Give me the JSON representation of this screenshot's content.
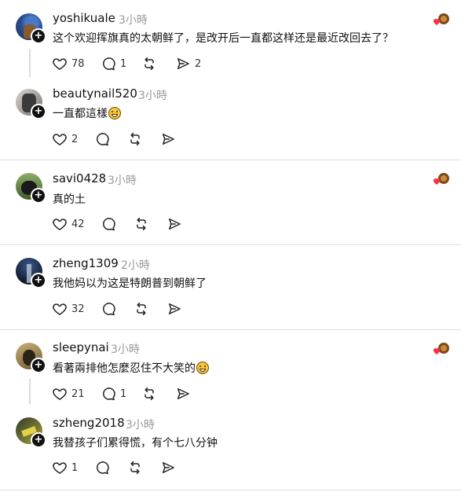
{
  "posts": [
    {
      "username": "yoshikuale",
      "time": "3小時",
      "text": "这个欢迎挥旗真的太朝鲜了，是改开后一直都这样还是最近改回去了？",
      "likes": "78",
      "replies": "1",
      "shares": "2",
      "liked_by_author": true
    },
    {
      "username": "beautynail520",
      "time": "3小時",
      "text": "一直都這樣",
      "likes": "2",
      "replies": "",
      "shares": "",
      "emoji": "grinning-face"
    },
    {
      "username": "savi0428",
      "time": "3小時",
      "text": "真的土",
      "likes": "42",
      "replies": "",
      "shares": "",
      "liked_by_author": true
    },
    {
      "username": "zheng1309",
      "time": "2小時",
      "text": "我他妈以为这是特朗普到朝鲜了",
      "likes": "32",
      "replies": "",
      "shares": ""
    },
    {
      "username": "sleepynai",
      "time": "3小時",
      "text": "看著兩排他怎麼忍住不大笑的",
      "likes": "21",
      "replies": "1",
      "shares": "",
      "liked_by_author": true,
      "emoji": "laughing-face"
    },
    {
      "username": "szheng2018",
      "time": "3小時",
      "text": "我替孩子们累得慌，有个七八分钟",
      "likes": "1",
      "replies": "",
      "shares": ""
    }
  ],
  "colors": {
    "text": "#111111",
    "muted": "#9a9a9a",
    "divider": "#dedede",
    "heart": "#ff3040"
  }
}
